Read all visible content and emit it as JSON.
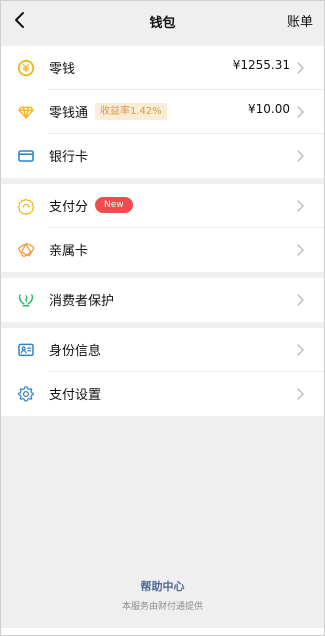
{
  "header": {
    "title": "钱包",
    "right_label": "账单",
    "back_icon": "back-arrow-icon"
  },
  "groups": [
    {
      "items": [
        {
          "label": "零钱",
          "value": "¥1255.31",
          "icon": "coin-icon"
        },
        {
          "label": "零钱通",
          "badge": "收益率1.42%",
          "value": "¥10.00",
          "icon": "diamond-icon"
        },
        {
          "label": "银行卡",
          "icon": "bank-card-icon"
        }
      ]
    },
    {
      "items": [
        {
          "label": "支付分",
          "badge": "New",
          "icon": "score-icon"
        },
        {
          "label": "亲属卡",
          "icon": "family-card-icon"
        }
      ]
    },
    {
      "items": [
        {
          "label": "消费者保护",
          "icon": "consumer-protection-icon"
        }
      ]
    },
    {
      "items": [
        {
          "label": "身份信息",
          "icon": "identity-card-icon"
        },
        {
          "label": "支付设置",
          "icon": "settings-icon"
        }
      ]
    }
  ],
  "footer": {
    "link": "帮助中心",
    "note": "本服务由财付通提供"
  },
  "colors": {
    "background": "#efefef",
    "card": "#ffffff",
    "text": "#111111",
    "muted": "#8d8d8d",
    "link": "#4c6b96",
    "coin": "#f2b51b",
    "bank": "#2f84c7",
    "badge_new": "#ef4d4d",
    "badge_rate_bg": "#fbecd7",
    "badge_rate_text": "#d59a47",
    "protection": "#35b56a",
    "family": "#f29c3a"
  }
}
